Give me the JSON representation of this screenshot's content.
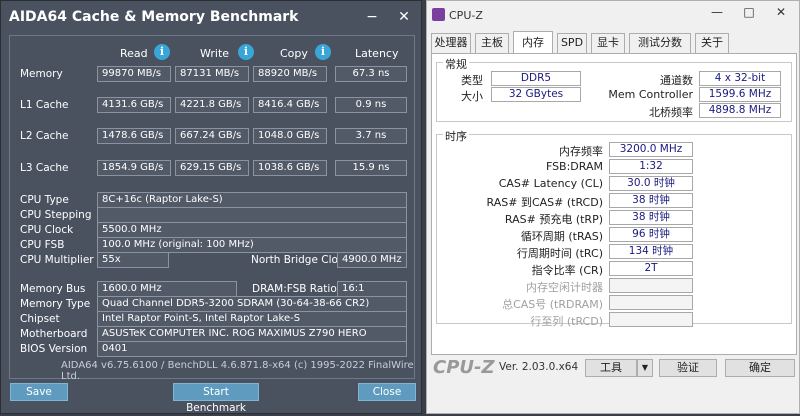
{
  "aida": {
    "title": "AIDA64 Cache & Memory Benchmark",
    "minimize": "−",
    "close": "✕",
    "columns": {
      "read": "Read",
      "write": "Write",
      "copy": "Copy",
      "latency": "Latency"
    },
    "info_glyph": "i",
    "bench": [
      {
        "label": "Memory",
        "read": "99870 MB/s",
        "write": "87131 MB/s",
        "copy": "88920 MB/s",
        "latency": "67.3 ns"
      },
      {
        "label": "L1 Cache",
        "read": "4131.6 GB/s",
        "write": "4221.8 GB/s",
        "copy": "8416.4 GB/s",
        "latency": "0.9 ns"
      },
      {
        "label": "L2 Cache",
        "read": "1478.6 GB/s",
        "write": "667.24 GB/s",
        "copy": "1048.0 GB/s",
        "latency": "3.7 ns"
      },
      {
        "label": "L3 Cache",
        "read": "1854.9 GB/s",
        "write": "629.15 GB/s",
        "copy": "1038.6 GB/s",
        "latency": "15.9 ns"
      }
    ],
    "cpu": {
      "type_label": "CPU Type",
      "type": "8C+16c   (Raptor Lake-S)",
      "stepping_label": "CPU Stepping",
      "stepping": "",
      "clock_label": "CPU Clock",
      "clock": "5500.0 MHz",
      "fsb_label": "CPU FSB",
      "fsb": "100.0 MHz  (original: 100 MHz)",
      "mult_label": "CPU Multiplier",
      "mult": "55x",
      "nb_label": "North Bridge Clock",
      "nb": "4900.0 MHz"
    },
    "mem": {
      "bus_label": "Memory Bus",
      "bus": "1600.0 MHz",
      "ratio_label": "DRAM:FSB Ratio",
      "ratio": "16:1",
      "type_label": "Memory Type",
      "type": "Quad Channel DDR5-3200 SDRAM  (30-64-38-66 CR2)",
      "chipset_label": "Chipset",
      "chipset": "Intel Raptor Point-S, Intel Raptor Lake-S",
      "mobo_label": "Motherboard",
      "mobo": "ASUSTeK COMPUTER INC. ROG MAXIMUS Z790 HERO",
      "bios_label": "BIOS Version",
      "bios": "0401"
    },
    "footer": "AIDA64 v6.75.6100 / BenchDLL 4.6.871.8-x64  (c) 1995-2022 FinalWire Ltd.",
    "save": "Save",
    "start": "Start Benchmark",
    "close_btn": "Close"
  },
  "cpuz": {
    "title": "CPU-Z",
    "win_min": "—",
    "win_max": "□",
    "win_close": "✕",
    "tabs": [
      "处理器",
      "主板",
      "内存",
      "SPD",
      "显卡",
      "测试分数",
      "关于"
    ],
    "general": {
      "title": "常规",
      "type_label": "类型",
      "type": "DDR5",
      "size_label": "大小",
      "size": "32 GBytes",
      "channels_label": "通道数",
      "channels": "4 x 32-bit",
      "mc_label": "Mem Controller",
      "mc": "1599.6 MHz",
      "nb_label": "北桥频率",
      "nb": "4898.8 MHz"
    },
    "timings": {
      "title": "时序",
      "rows": [
        {
          "label": "内存频率",
          "value": "3200.0 MHz"
        },
        {
          "label": "FSB:DRAM",
          "value": "1:32"
        },
        {
          "label": "CAS# Latency (CL)",
          "value": "30.0 时钟"
        },
        {
          "label": "RAS# 到CAS# (tRCD)",
          "value": "38 时钟"
        },
        {
          "label": "RAS# 预充电 (tRP)",
          "value": "38 时钟"
        },
        {
          "label": "循环周期 (tRAS)",
          "value": "96 时钟"
        },
        {
          "label": "行周期时间 (tRC)",
          "value": "134 时钟"
        },
        {
          "label": "指令比率 (CR)",
          "value": "2T"
        },
        {
          "label": "内存空闲计时器",
          "value": ""
        },
        {
          "label": "总CAS号 (tRDRAM)",
          "value": ""
        },
        {
          "label": "行至列 (tRCD)",
          "value": ""
        }
      ]
    },
    "logo": "CPU-Z",
    "version": "Ver. 2.03.0.x64",
    "tools": "工具",
    "dropdown": "▼",
    "validate": "验证",
    "ok": "确定"
  }
}
